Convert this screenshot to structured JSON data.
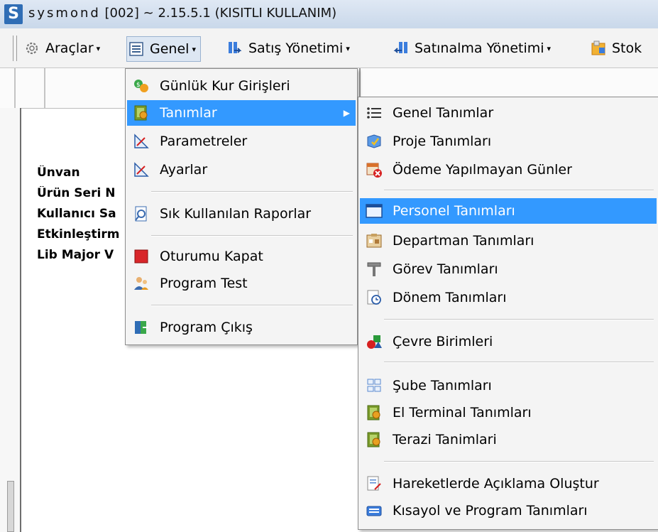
{
  "window": {
    "brand": "sysmond",
    "title_rest": "[002] ~ 2.15.5.1  (KISITLI KULLANIM)",
    "logo_letter": "S"
  },
  "toolbar": {
    "items": [
      {
        "label": "Araçlar",
        "icon": "gear-icon"
      },
      {
        "label": "Genel",
        "icon": "list-icon"
      },
      {
        "label": "Satış Yönetimi",
        "icon": "sales-icon"
      },
      {
        "label": "Satınalma Yönetimi",
        "icon": "purchase-icon"
      },
      {
        "label": "Stok",
        "icon": "stock-icon"
      }
    ],
    "dropdown_glyph": "▾"
  },
  "info_labels": [
    "Ünvan",
    "Ürün Seri N",
    "Kullanıcı Sa",
    "Etkinleştirm",
    "Lib Major V"
  ],
  "genel_menu": {
    "items": [
      {
        "label": "Günlük Kur Girişleri",
        "icon": "currency-icon"
      },
      {
        "label": "Tanımlar",
        "icon": "definitions-icon",
        "selected": true,
        "submenu_glyph": "▶"
      },
      {
        "label": "Parametreler",
        "icon": "ruler-icon"
      },
      {
        "label": "Ayarlar",
        "icon": "ruler-icon"
      },
      {
        "label": "Sık Kullanılan Raporlar",
        "icon": "report-icon"
      },
      {
        "label": "Oturumu Kapat",
        "icon": "logout-icon"
      },
      {
        "label": "Program Test",
        "icon": "users-icon"
      },
      {
        "label": "Program Çıkış",
        "icon": "exit-icon"
      }
    ]
  },
  "tanimlar_menu": {
    "items": [
      {
        "label": "Genel Tanımlar",
        "icon": "list-bullets-icon"
      },
      {
        "label": "Proje Tanımları",
        "icon": "project-icon"
      },
      {
        "label": "Ödeme Yapılmayan Günler",
        "icon": "calendar-x-icon"
      },
      {
        "label": "Personel Tanımları",
        "icon": "window-icon",
        "selected": true
      },
      {
        "label": "Departman Tanımları",
        "icon": "department-icon"
      },
      {
        "label": "Görev Tanımları",
        "icon": "tool-icon"
      },
      {
        "label": "Dönem Tanımları",
        "icon": "period-icon"
      },
      {
        "label": "Çevre Birimleri",
        "icon": "shapes-icon"
      },
      {
        "label": "Şube Tanımları",
        "icon": "branch-icon"
      },
      {
        "label": "El Terminal Tanımları",
        "icon": "definitions-icon"
      },
      {
        "label": "Terazi Tanimlari",
        "icon": "definitions-icon"
      },
      {
        "label": "Hareketlerde Açıklama Oluştur",
        "icon": "note-icon"
      },
      {
        "label": "Kısayol ve Program Tanımları",
        "icon": "keyboard-icon"
      }
    ]
  }
}
